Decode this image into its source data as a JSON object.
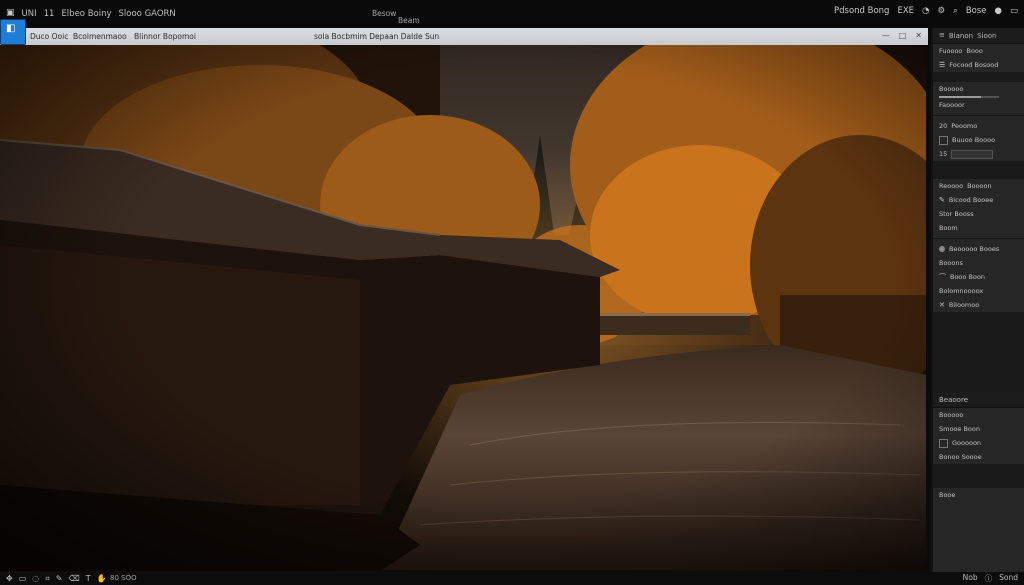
{
  "menubar": {
    "items": [
      "UNI",
      "11",
      "Elbeo Boiny",
      "Slooo GAORN"
    ],
    "center_top": "Besow",
    "center_bottom": "Beam",
    "right_text": "Pdsond Bong",
    "right_extra": "EXE",
    "right_tail": "Bose"
  },
  "tabs": {
    "app_icon": "app-icon",
    "labels": [
      "Duco Ooic",
      "Bcolmenmaoo",
      "Blinnor Bopomoi"
    ],
    "center_label": "sola Bocbmim Depaan Dalde Sun"
  },
  "panel": {
    "header": [
      "Bianon",
      "Sioon"
    ],
    "rows": [
      "Fuoooo",
      "Booo",
      "Focood Bosood",
      "Booooo",
      "Faoooor",
      "Peoomo",
      "Buuoo Boooo",
      "Reoooo",
      "Boooon",
      "Bicood Booee",
      "Stor Booss",
      "Boom",
      "Beooooo Booes",
      "Booons",
      "Booo Boon",
      "Bolomnoooox",
      "Biloomoo",
      "Beaoore",
      "Booooo",
      "Smooe Boon",
      "Gooooon",
      "Bonoo Soooe",
      "Booe"
    ],
    "number_a": "20",
    "number_b": "15"
  },
  "status": {
    "zoom": "80 SOO",
    "right": [
      "Nob",
      "Sond"
    ]
  },
  "colors": {
    "accent": "#1f7fd6",
    "panel_bg": "#262626",
    "canvas_bg": "#120c07",
    "foliage": "#c9741d"
  }
}
